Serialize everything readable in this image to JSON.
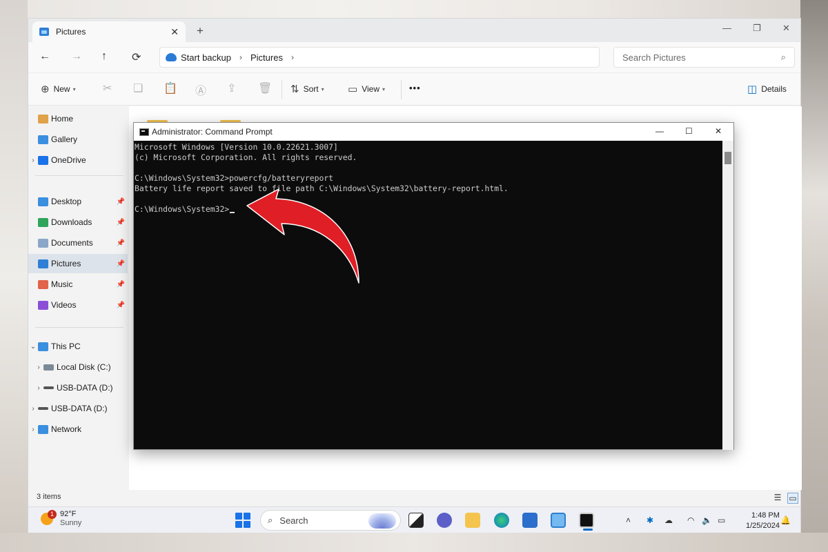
{
  "explorer": {
    "tab_title": "Pictures",
    "address": {
      "crumbs": [
        "Start backup",
        "Pictures"
      ]
    },
    "search_placeholder": "Search Pictures",
    "toolbar": {
      "new_label": "New",
      "sort_label": "Sort",
      "view_label": "View",
      "details_label": "Details",
      "more_label": "•••"
    },
    "sidebar": {
      "home": "Home",
      "gallery": "Gallery",
      "onedrive": "OneDrive",
      "desktop": "Desktop",
      "downloads": "Downloads",
      "documents": "Documents",
      "pictures": "Pictures",
      "music": "Music",
      "videos": "Videos",
      "this_pc": "This PC",
      "local_disk": "Local Disk (C:)",
      "usb_data_1": "USB-DATA (D:)",
      "usb_data_2": "USB-DATA (D:)",
      "network": "Network"
    },
    "status": {
      "items": "3 items"
    }
  },
  "cmd": {
    "title": "Administrator: Command Prompt",
    "lines": [
      "Microsoft Windows [Version 10.0.22621.3007]",
      "(c) Microsoft Corporation. All rights reserved.",
      "",
      "C:\\Windows\\System32>powercfg/batteryreport",
      "Battery life report saved to file path C:\\Windows\\System32\\battery-report.html.",
      "",
      "C:\\Windows\\System32>"
    ]
  },
  "taskbar": {
    "weather": {
      "temp": "92°F",
      "condition": "Sunny",
      "badge": "1"
    },
    "search_label": "Search",
    "clock": {
      "time": "1:48 PM",
      "date": "1/25/2024"
    }
  },
  "colors": {
    "accent": "#0067c0",
    "arrow": "#e01e26",
    "console_bg": "#0c0c0c"
  },
  "icons": {
    "back": "←",
    "forward": "→",
    "up": "↑",
    "refresh": "⟳",
    "close": "✕",
    "chevron_right": "›",
    "search": "⌕"
  }
}
